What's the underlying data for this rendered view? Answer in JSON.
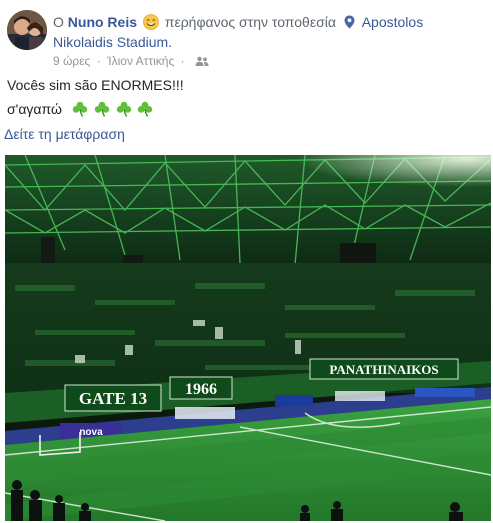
{
  "post": {
    "author": "Nuno Reis",
    "prefix": "O",
    "feeling": "περήφανος στην τοποθεσία",
    "location": "Apostolos Nikolaidis Stadium.",
    "location_line1": "Apostolos",
    "location_line2": "Nikolaidis Stadium.",
    "time": "9 ώρες",
    "separator": "·",
    "place": "Ίλιον Αττικής",
    "separator2": "·",
    "audience_icon": "friends-icon",
    "text_line1": "Vocês sim são ENORMES!!!",
    "text_line2": "σ'αγαπώ",
    "translate_link": "Δείτε τη μετάφραση"
  },
  "photo": {
    "banner_left": "GATE 13",
    "banner_year": "1966",
    "banner_right": "PANATHINAIKOS",
    "ad_text": "nova"
  },
  "colors": {
    "link": "#385898",
    "meta": "#90949c",
    "text": "#1d2129",
    "clover": "#5fbf3a",
    "pitch": "#2f8f36"
  }
}
